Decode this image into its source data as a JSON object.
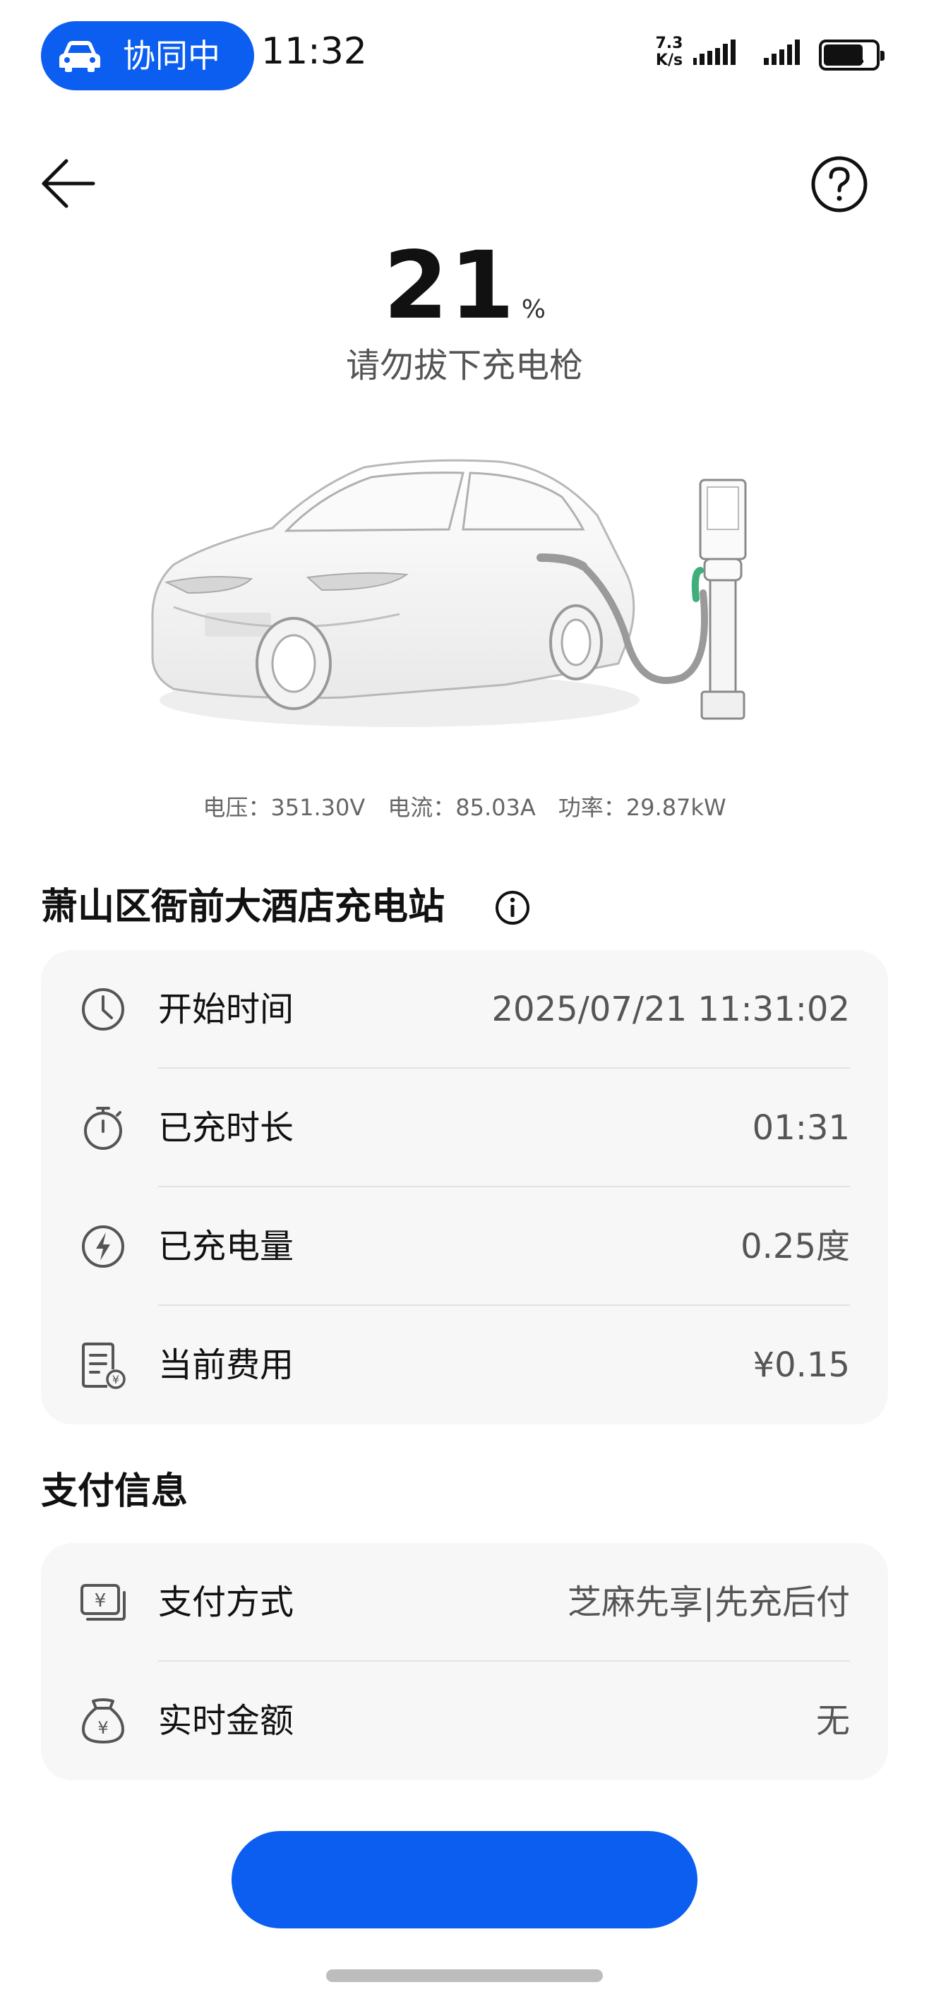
{
  "status_bar": {
    "collab_label": "协同中",
    "time": "11:32",
    "net_speed_value": "7.3",
    "net_speed_unit": "K/s",
    "battery_level": "71"
  },
  "charging": {
    "percent": "21",
    "percent_unit": "%",
    "hint": "请勿拔下充电枪",
    "metrics": {
      "voltage": "电压：351.30V",
      "current": "电流：85.03A",
      "power": "功率：29.87kW"
    }
  },
  "station": {
    "name": "萧山区衙前大酒店充电站",
    "rows": [
      {
        "icon": "clock-icon",
        "label": "开始时间",
        "value": "2025/07/21 11:31:02"
      },
      {
        "icon": "stopwatch-icon",
        "label": "已充时长",
        "value": "01:31"
      },
      {
        "icon": "lightning-icon",
        "label": "已充电量",
        "value": "0.25度"
      },
      {
        "icon": "bill-icon",
        "label": "当前费用",
        "value": "¥0.15"
      }
    ]
  },
  "payment": {
    "title": "支付信息",
    "rows": [
      {
        "icon": "yuan-card-icon",
        "label": "支付方式",
        "value": "芝麻先享|先充后付"
      },
      {
        "icon": "money-bag-icon",
        "label": "实时金额",
        "value": "无"
      }
    ]
  },
  "colors": {
    "accent": "#0b5ef0",
    "card_bg": "#f7f7f7",
    "charger_green": "#3fae7a"
  }
}
